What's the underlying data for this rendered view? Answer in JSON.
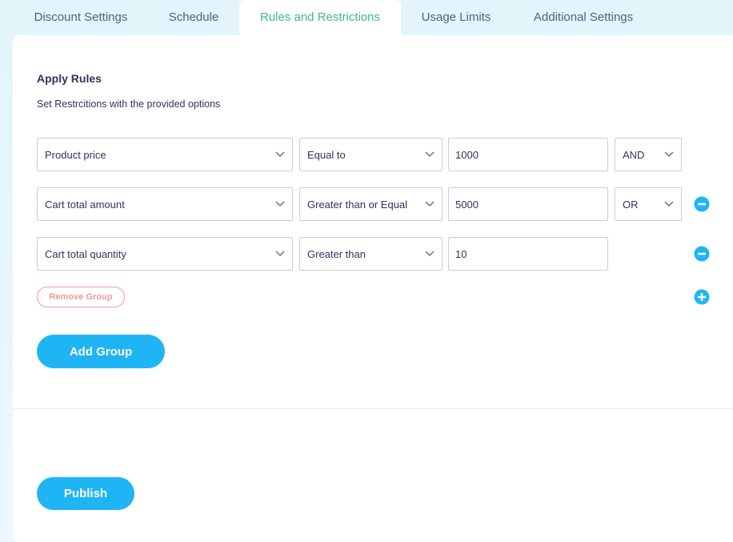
{
  "tabs": [
    {
      "label": "Discount Settings",
      "active": false
    },
    {
      "label": "Schedule",
      "active": false
    },
    {
      "label": "Rules and Restrictions",
      "active": true
    },
    {
      "label": "Usage Limits",
      "active": false
    },
    {
      "label": "Additional Settings",
      "active": false
    }
  ],
  "section": {
    "title": "Apply Rules",
    "subtitle": "Set Restrcitions with the provided options"
  },
  "rules": [
    {
      "field": "Product price",
      "operator": "Equal to",
      "value": "1000",
      "connector": "AND",
      "action": "none"
    },
    {
      "field": "Cart total amount",
      "operator": "Greater than or Equal",
      "value": "5000",
      "connector": "OR",
      "action": "remove-icon"
    },
    {
      "field": "Cart total quantity",
      "operator": "Greater than",
      "value": "10",
      "connector": "",
      "action": "remove-icon"
    }
  ],
  "buttons": {
    "remove_group": "Remove Group",
    "add_group": "Add Group",
    "publish": "Publish"
  },
  "colors": {
    "accent": "#1fb5f5",
    "active_tab": "#3cb891",
    "danger": "#f29a9a"
  }
}
